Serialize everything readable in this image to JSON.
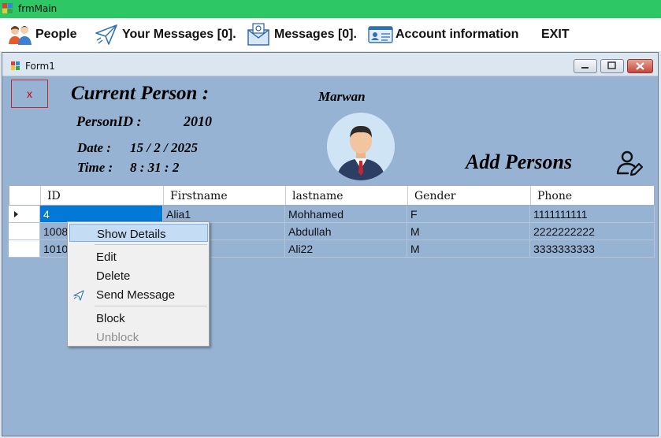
{
  "window": {
    "title": "frmMain"
  },
  "menu": {
    "items": [
      {
        "label": "People",
        "icon": "people-icon"
      },
      {
        "label": "Your Messages [0].",
        "icon": "paper-plane-icon"
      },
      {
        "label": "Messages [0].",
        "icon": "mail-envelope-icon"
      },
      {
        "label": "Account information",
        "icon": "id-card-icon"
      },
      {
        "label": "EXIT"
      }
    ]
  },
  "child_form": {
    "title": "Form1",
    "close_label": "x",
    "current_person_label": "Current Person :",
    "person_name": "Marwan",
    "person_id_label": "PersonID :",
    "person_id_value": "2010",
    "date_label": "Date :",
    "date_value": "15 / 2 / 2025",
    "time_label": "Time :",
    "time_value": "8 : 31 : 2",
    "add_persons_label": "Add Persons"
  },
  "grid": {
    "columns": [
      "ID",
      "Firstname",
      "lastname",
      "Gender",
      "Phone"
    ],
    "rows": [
      {
        "id": "4",
        "firstname": "Alia1",
        "lastname": "Mohhamed",
        "gender": "F",
        "phone": "1111111111"
      },
      {
        "id": "1008",
        "firstname": "",
        "lastname": "Abdullah",
        "gender": "M",
        "phone": "2222222222"
      },
      {
        "id": "1010",
        "firstname": "",
        "lastname": "Ali22",
        "gender": "M",
        "phone": "3333333333"
      }
    ]
  },
  "context_menu": {
    "items": [
      "Show Details",
      "Edit",
      "Delete",
      "Send Message",
      "Block",
      "Unblock"
    ],
    "disabled": [
      "Unblock"
    ],
    "hovered": "Show Details"
  },
  "colors": {
    "title_bar": "#2dc865",
    "form_background": "#97b3d3",
    "selection": "#0078d7",
    "menu_hover": "#c5dcf5"
  }
}
